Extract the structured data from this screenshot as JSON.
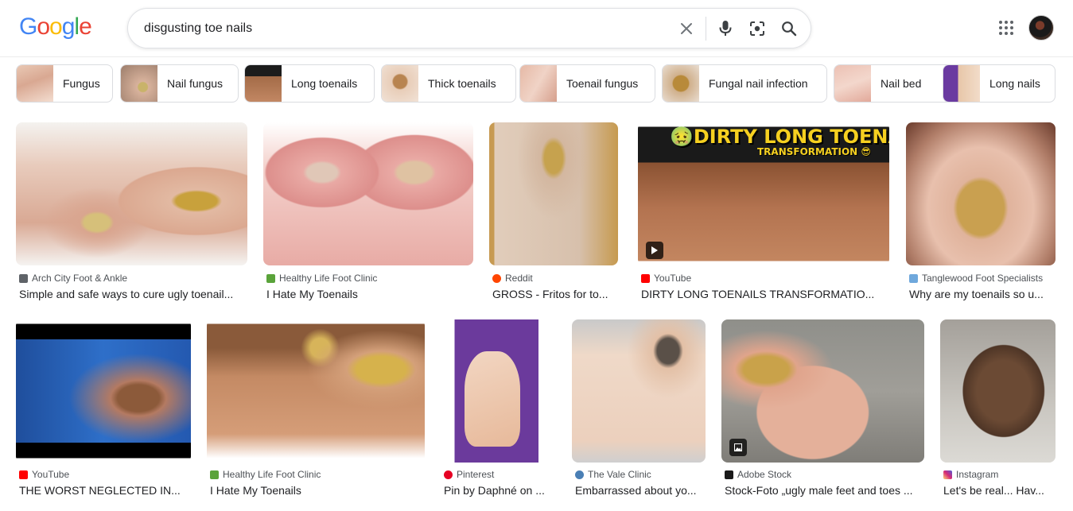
{
  "logo": {
    "text": "Google",
    "letters": [
      "G",
      "o",
      "o",
      "g",
      "l",
      "e"
    ],
    "colors": [
      "#4285f4",
      "#ea4335",
      "#fbbc05",
      "#4285f4",
      "#34a853",
      "#ea4335"
    ]
  },
  "search": {
    "query": "disgusting toe nails"
  },
  "icons": {
    "clear": "close-icon",
    "mic": "microphone-icon",
    "lens": "camera-lens-icon",
    "search": "search-icon",
    "apps": "apps-grid-icon"
  },
  "chips": [
    {
      "label": "Fungus"
    },
    {
      "label": "Nail fungus"
    },
    {
      "label": "Long toenails"
    },
    {
      "label": "Thick toenails"
    },
    {
      "label": "Toenail fungus"
    },
    {
      "label": "Fungal nail infection"
    },
    {
      "label": "Nail bed"
    },
    {
      "label": "Long nails"
    }
  ],
  "results": [
    {
      "source": "Arch City Foot & Ankle",
      "title": "Simple and safe ways to cure ugly toenail...",
      "fav_color": "#5f6368"
    },
    {
      "source": "Healthy Life Foot Clinic",
      "title": "I Hate My Toenails",
      "fav_color": "#5aa33a"
    },
    {
      "source": "Reddit",
      "title": "GROSS - Fritos for to...",
      "fav_color": "#ff4500"
    },
    {
      "source": "YouTube",
      "title": "DIRTY LONG TOENAILS TRANSFORMATIO...",
      "fav_color": "#ff0000",
      "banner": "🤢DIRTY LONG TOENAILS",
      "banner_sub": "TRANSFORMATION 😎"
    },
    {
      "source": "Tanglewood Foot Specialists",
      "title": "Why are my toenails so u...",
      "fav_color": "#6fa8dc"
    },
    {
      "source": "YouTube",
      "title": "THE WORST NEGLECTED IN...",
      "fav_color": "#ff0000"
    },
    {
      "source": "Healthy Life Foot Clinic",
      "title": "I Hate My Toenails",
      "fav_color": "#5aa33a"
    },
    {
      "source": "Pinterest",
      "title": "Pin by Daphné on ...",
      "fav_color": "#e60023"
    },
    {
      "source": "The Vale Clinic",
      "title": "Embarrassed about yo...",
      "fav_color": "#4a7fb5"
    },
    {
      "source": "Adobe Stock",
      "title": "Stock-Foto „ugly male feet and toes ...",
      "fav_color": "#1a1a1a"
    },
    {
      "source": "Instagram",
      "title": "Let's be real... Hav...",
      "fav_color": "#d6249f"
    }
  ]
}
